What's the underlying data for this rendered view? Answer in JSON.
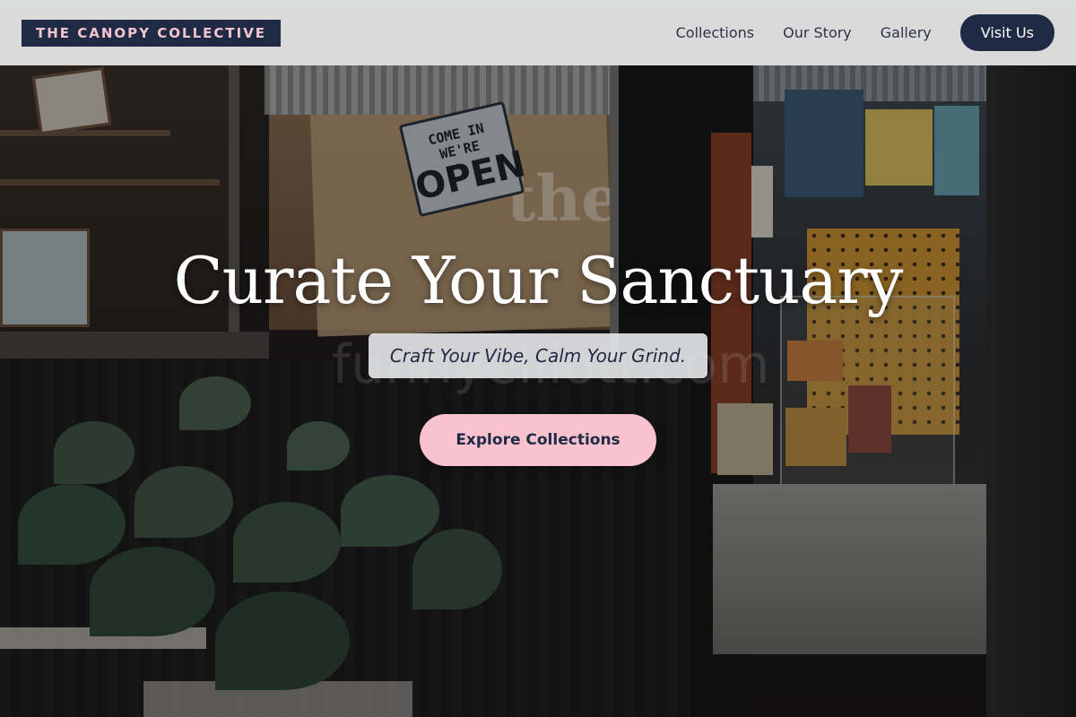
{
  "brand": {
    "logo_text": "THE CANOPY COLLECTIVE"
  },
  "nav": {
    "links": [
      "Collections",
      "Our Story",
      "Gallery"
    ],
    "cta_label": "Visit Us"
  },
  "hero": {
    "title": "Curate Your Sanctuary",
    "tagline": "Craft Your Vibe, Calm Your Grind.",
    "cta_label": "Explore Collections",
    "watermark": "funnyelliott.com"
  },
  "background_scene": {
    "open_sign_small": "COME IN WE'RE",
    "open_sign_big": "OPEN",
    "window_lettering": "the"
  },
  "colors": {
    "navy": "#1f2a44",
    "pink": "#f9c2cf",
    "nav_bg": "#e8e9eb"
  }
}
